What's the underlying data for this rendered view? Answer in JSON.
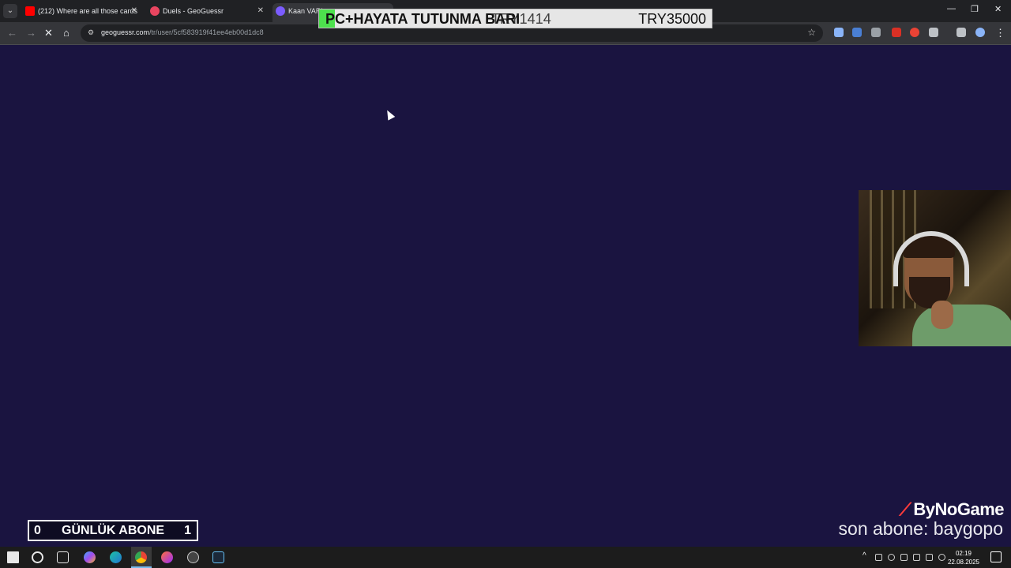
{
  "browser": {
    "tabs": [
      {
        "title": "(212) Where are all those cards",
        "icon": "youtube-icon",
        "color": "#ff0000"
      },
      {
        "title": "Duels - GeoGuessr",
        "icon": "geoguessr-pin-icon",
        "color": "#e94560"
      },
      {
        "title": "Kaan VARL",
        "icon": "geoguessr-profile-icon",
        "color": "#7b5cff"
      }
    ],
    "url_host": "geoguessr.com",
    "url_path": "/tr/user/5cf583919f41ee4eb00d1dc8",
    "window_controls": {
      "minimize": "—",
      "restore": "❐",
      "close": "✕"
    }
  },
  "overlay": {
    "goal_bar": {
      "label": "PC+HAYATA TUTUNMA BARI",
      "current": "TRY1414",
      "goal": "TRY35000",
      "progress_fraction": 0.04,
      "fill_color": "#4de04d"
    },
    "daily_subs": {
      "left": "0",
      "label": "GÜNLÜK ABONE",
      "right": "1"
    },
    "brand": "ByNoGame",
    "last_sub": "son abone: baygopo"
  },
  "page": {
    "background": "#1a1440"
  },
  "taskbar": {
    "time": "02:19",
    "date": "22.08.2025"
  }
}
